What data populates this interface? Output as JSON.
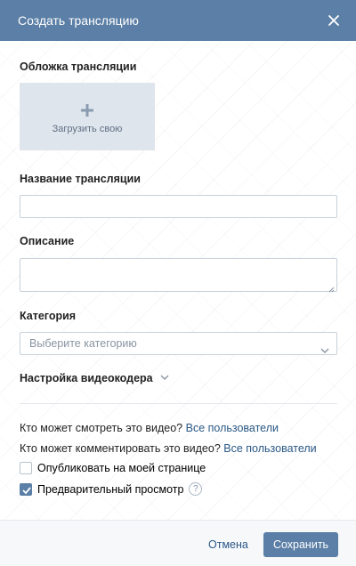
{
  "header": {
    "title": "Создать трансляцию",
    "close_icon": "close-icon"
  },
  "cover": {
    "label": "Обложка трансляции",
    "upload_label": "Загрузить свою",
    "icon": "plus-icon"
  },
  "name_field": {
    "label": "Название трансляции",
    "value": "",
    "placeholder": ""
  },
  "description_field": {
    "label": "Описание",
    "value": "",
    "placeholder": ""
  },
  "category": {
    "label": "Категория",
    "selected": "Выберите категорию",
    "icon": "chevron-down-icon"
  },
  "encoder": {
    "label": "Настройка видеокодера",
    "icon": "chevron-down-icon"
  },
  "privacy": {
    "view_question": "Кто может смотреть это видео?",
    "view_value": "Все пользователи",
    "comment_question": "Кто может комментировать это видео?",
    "comment_value": "Все пользователи"
  },
  "options": {
    "publish_label": "Опубликовать на моей странице",
    "publish_checked": false,
    "preview_label": "Предварительный просмотр",
    "preview_checked": true,
    "help_icon": "question-icon",
    "help_glyph": "?"
  },
  "footer": {
    "cancel_label": "Отмена",
    "save_label": "Сохранить"
  },
  "colors": {
    "accent": "#5b7fa6",
    "link": "#2a5885",
    "footer_bg": "#f7f8fa",
    "cover_bg": "#dfe5ec"
  }
}
